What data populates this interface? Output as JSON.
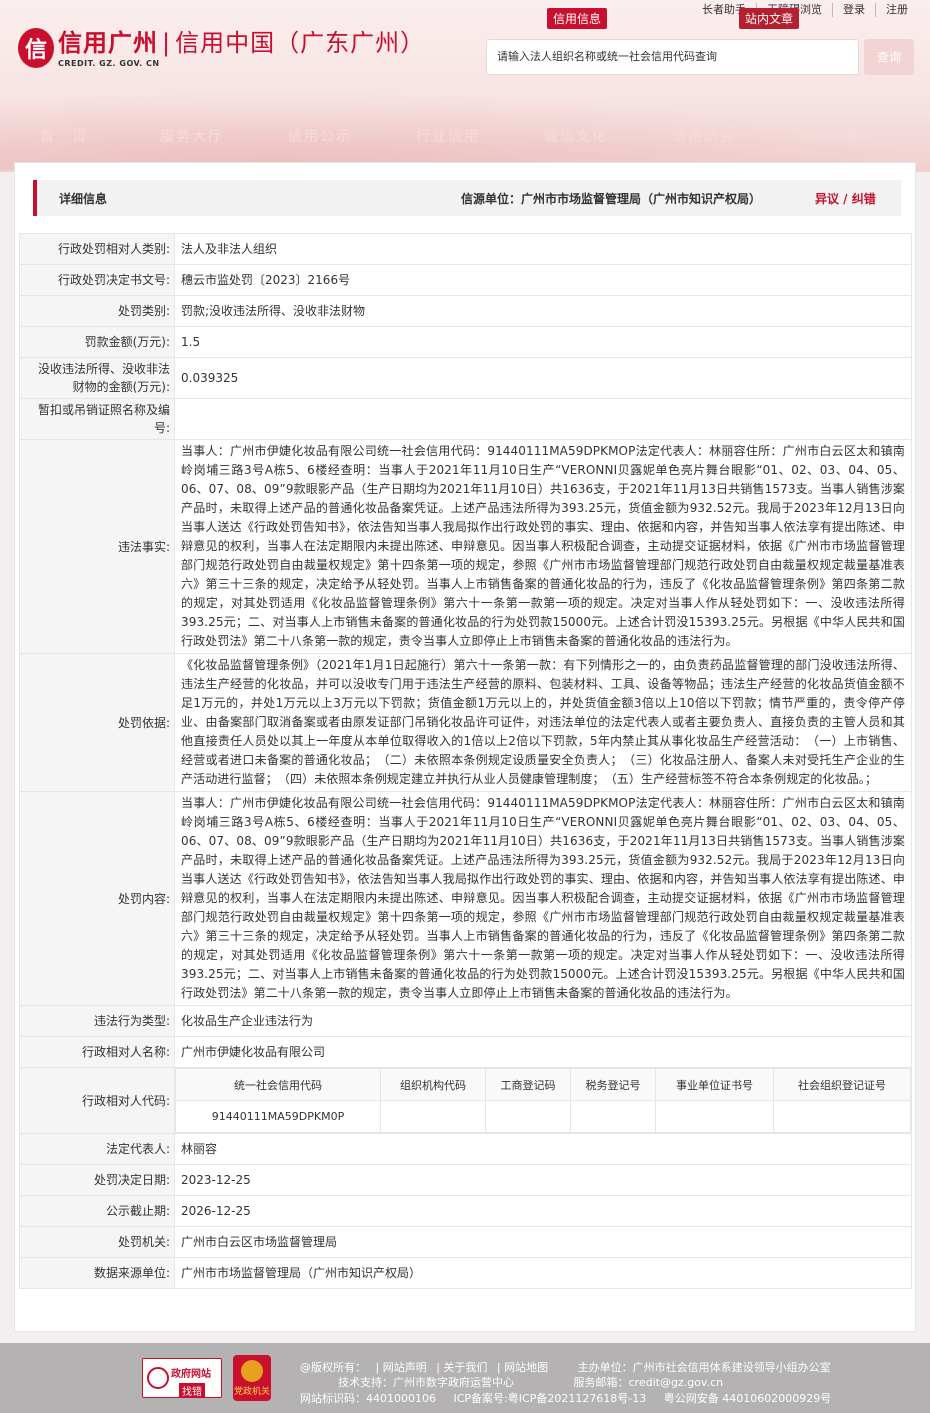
{
  "header": {
    "topbar": [
      "长者助手",
      "无障碍浏览",
      "登录",
      "注册"
    ],
    "logo_mark": "信",
    "logo_cn_1": "信用广州",
    "logo_cn_sep": "|",
    "logo_cn_2": "信用中国（广东广州）",
    "logo_en": "CREDIT. GZ. GOV. CN",
    "search_tabs": [
      "信用信息",
      "站内文章"
    ],
    "search_placeholder": "请输入法人组织名称或统一社会信用代码查询",
    "search_button": "查询",
    "nav": [
      "首　页",
      "服务大厅",
      "信用公示",
      "行业信用",
      "诚信文化",
      "信用研究",
      "信用创新"
    ]
  },
  "panel": {
    "title": "详细信息",
    "source": "信源单位：广州市市场监督管理局（广州市知识产权局）",
    "objection": "异议 / 纠错"
  },
  "rows": {
    "r1": {
      "label": "行政处罚相对人类别:",
      "value": "法人及非法人组织"
    },
    "r2": {
      "label": "行政处罚决定书文号:",
      "value": "穗云市监处罚〔2023〕2166号"
    },
    "r3": {
      "label": "处罚类别:",
      "value": "罚款;没收违法所得、没收非法财物"
    },
    "r4": {
      "label": "罚款金额(万元):",
      "value": "1.5"
    },
    "r5": {
      "label": "没收违法所得、没收非法财物的金额(万元):",
      "value": "0.039325"
    },
    "r6": {
      "label": "暂扣或吊销证照名称及编号:",
      "value": ""
    },
    "r7": {
      "label": "违法事实:",
      "value": "当事人：广州市伊婕化妆品有限公司统一社会信用代码：91440111MA59DPKMOP法定代表人：林丽容住所：广州市白云区太和镇南岭岗埔三路3号A栋5、6楼经查明：当事人于2021年11月10日生产“VERONNI贝露妮单色亮片舞台眼影“01、02、03、04、05、06、07、08、09”9款眼影产品（生产日期均为2021年11月10日）共1636支，于2021年11月13日共销售1573支。当事人销售涉案产品时，未取得上述产品的普通化妆品备案凭证。上述产品违法所得为393.25元，货值金额为932.52元。我局于2023年12月13日向当事人送达《行政处罚告知书》，依法告知当事人我局拟作出行政处罚的事实、理由、依据和内容，并告知当事人依法享有提出陈述、申辩意见的权利，当事人在法定期限内未提出陈述、申辩意见。因当事人积极配合调查，主动提交证据材料，依据《广州市市场监督管理部门规范行政处罚自由裁量权规定》第十四条第一项的规定，参照《广州市市场监督管理部门规范行政处罚自由裁量权规定裁量基准表六》第三十三条的规定，决定给予从轻处罚。当事人上市销售备案的普通化妆品的行为，违反了《化妆品监督管理条例》第四条第二款的规定，对其处罚适用《化妆品监督管理条例》第六十一条第一款第一项的规定。决定对当事人作从轻处罚如下：一、没收违法所得393.25元；二、对当事人上市销售未备案的普通化妆品的行为处罚款15000元。上述合计罚没15393.25元。另根据《中华人民共和国行政处罚法》第二十八条第一款的规定，责令当事人立即停止上市销售未备案的普通化妆品的违法行为。"
    },
    "r8": {
      "label": "处罚依据:",
      "value": "《化妆品监督管理条例》（2021年1月1日起施行）第六十一条第一款：有下列情形之一的，由负责药品监督管理的部门没收违法所得、违法生产经营的化妆品，并可以没收专门用于违法生产经营的原料、包装材料、工具、设备等物品；违法生产经营的化妆品货值金额不足1万元的，并处1万元以上3万元以下罚款；货值金额1万元以上的，并处货值金额3倍以上10倍以下罚款；情节严重的，责令停产停业、由备案部门取消备案或者由原发证部门吊销化妆品许可证件，对违法单位的法定代表人或者主要负责人、直接负责的主管人员和其他直接责任人员处以其上一年度从本单位取得收入的1倍以上2倍以下罚款，5年内禁止其从事化妆品生产经营活动：　（一）上市销售、经营或者进口未备案的普通化妆品；　（二）未依照本条例规定设质量安全负责人；　（三）化妆品注册人、备案人未对受托生产企业的生产活动进行监督；　（四）未依照本条例规定建立并执行从业人员健康管理制度；　（五）生产经营标签不符合本条例规定的化妆品。；"
    },
    "r9": {
      "label": "处罚内容:",
      "value": "当事人：广州市伊婕化妆品有限公司统一社会信用代码：91440111MA59DPKMOP法定代表人：林丽容住所：广州市白云区太和镇南岭岗埔三路3号A栋5、6楼经查明：当事人于2021年11月10日生产“VERONNI贝露妮单色亮片舞台眼影“01、02、03、04、05、06、07、08、09”9款眼影产品（生产日期均为2021年11月10日）共1636支，于2021年11月13日共销售1573支。当事人销售涉案产品时，未取得上述产品的普通化妆品备案凭证。上述产品违法所得为393.25元，货值金额为932.52元。我局于2023年12月13日向当事人送达《行政处罚告知书》，依法告知当事人我局拟作出行政处罚的事实、理由、依据和内容，并告知当事人依法享有提出陈述、申辩意见的权利，当事人在法定期限内未提出陈述、申辩意见。因当事人积极配合调查，主动提交证据材料，依据《广州市市场监督管理部门规范行政处罚自由裁量权规定》第十四条第一项的规定，参照《广州市市场监督管理部门规范行政处罚自由裁量权规定裁量基准表六》第三十三条的规定，决定给予从轻处罚。当事人上市销售备案的普通化妆品的行为，违反了《化妆品监督管理条例》第四条第二款的规定，对其处罚适用《化妆品监督管理条例》第六十一条第一款第一项的规定。决定对当事人作从轻处罚如下：一、没收违法所得393.25元；二、对当事人上市销售未备案的普通化妆品的行为处罚款15000元。上述合计罚没15393.25元。另根据《中华人民共和国行政处罚法》第二十八条第一款的规定，责令当事人立即停止上市销售未备案的普通化妆品的违法行为。"
    },
    "r10": {
      "label": "违法行为类型:",
      "value": "化妆品生产企业违法行为"
    },
    "r11": {
      "label": "行政相对人名称:",
      "value": "广州市伊婕化妆品有限公司"
    },
    "r12": {
      "label": "行政相对人代码:",
      "value": ""
    },
    "r13": {
      "label": "法定代表人:",
      "value": "林丽容"
    },
    "r14": {
      "label": "处罚决定日期:",
      "value": "2023-12-25"
    },
    "r15": {
      "label": "公示截止期:",
      "value": "2026-12-25"
    },
    "r16": {
      "label": "处罚机关:",
      "value": "广州市白云区市场监督管理局"
    },
    "r17": {
      "label": "数据来源单位:",
      "value": "广州市市场监督管理局（广州市知识产权局）"
    }
  },
  "codes": {
    "headers": [
      "统一社会信用代码",
      "组织机构代码",
      "工商登记码",
      "税务登记号",
      "事业单位证书号",
      "社会组织登记证号"
    ],
    "values": [
      "91440111MA59DPKM0P",
      "",
      "",
      "",
      "",
      ""
    ]
  },
  "footer": {
    "gov_badge_1": "政府网站",
    "gov_badge_2": "找错",
    "party_badge": "党政机关",
    "line1": [
      "@版权所有：",
      "| 网站声明",
      "| 关于我们",
      "| 网站地图",
      "主办单位：广州市社会信用体系建设领导小组办公室"
    ],
    "line2": [
      "技术支持：广州市数字政府运营中心",
      "服务邮箱：credit@gz.gov.cn"
    ],
    "line3": [
      "网站标识码：4401000106",
      "ICP备案号:粤ICP备2021127618号-13",
      "粤公网安备 44010602000929号"
    ]
  },
  "colors": {
    "brand": "#c8102e",
    "label_bg": "#f5f5f5",
    "footer_bg": "#b4b2b2"
  }
}
